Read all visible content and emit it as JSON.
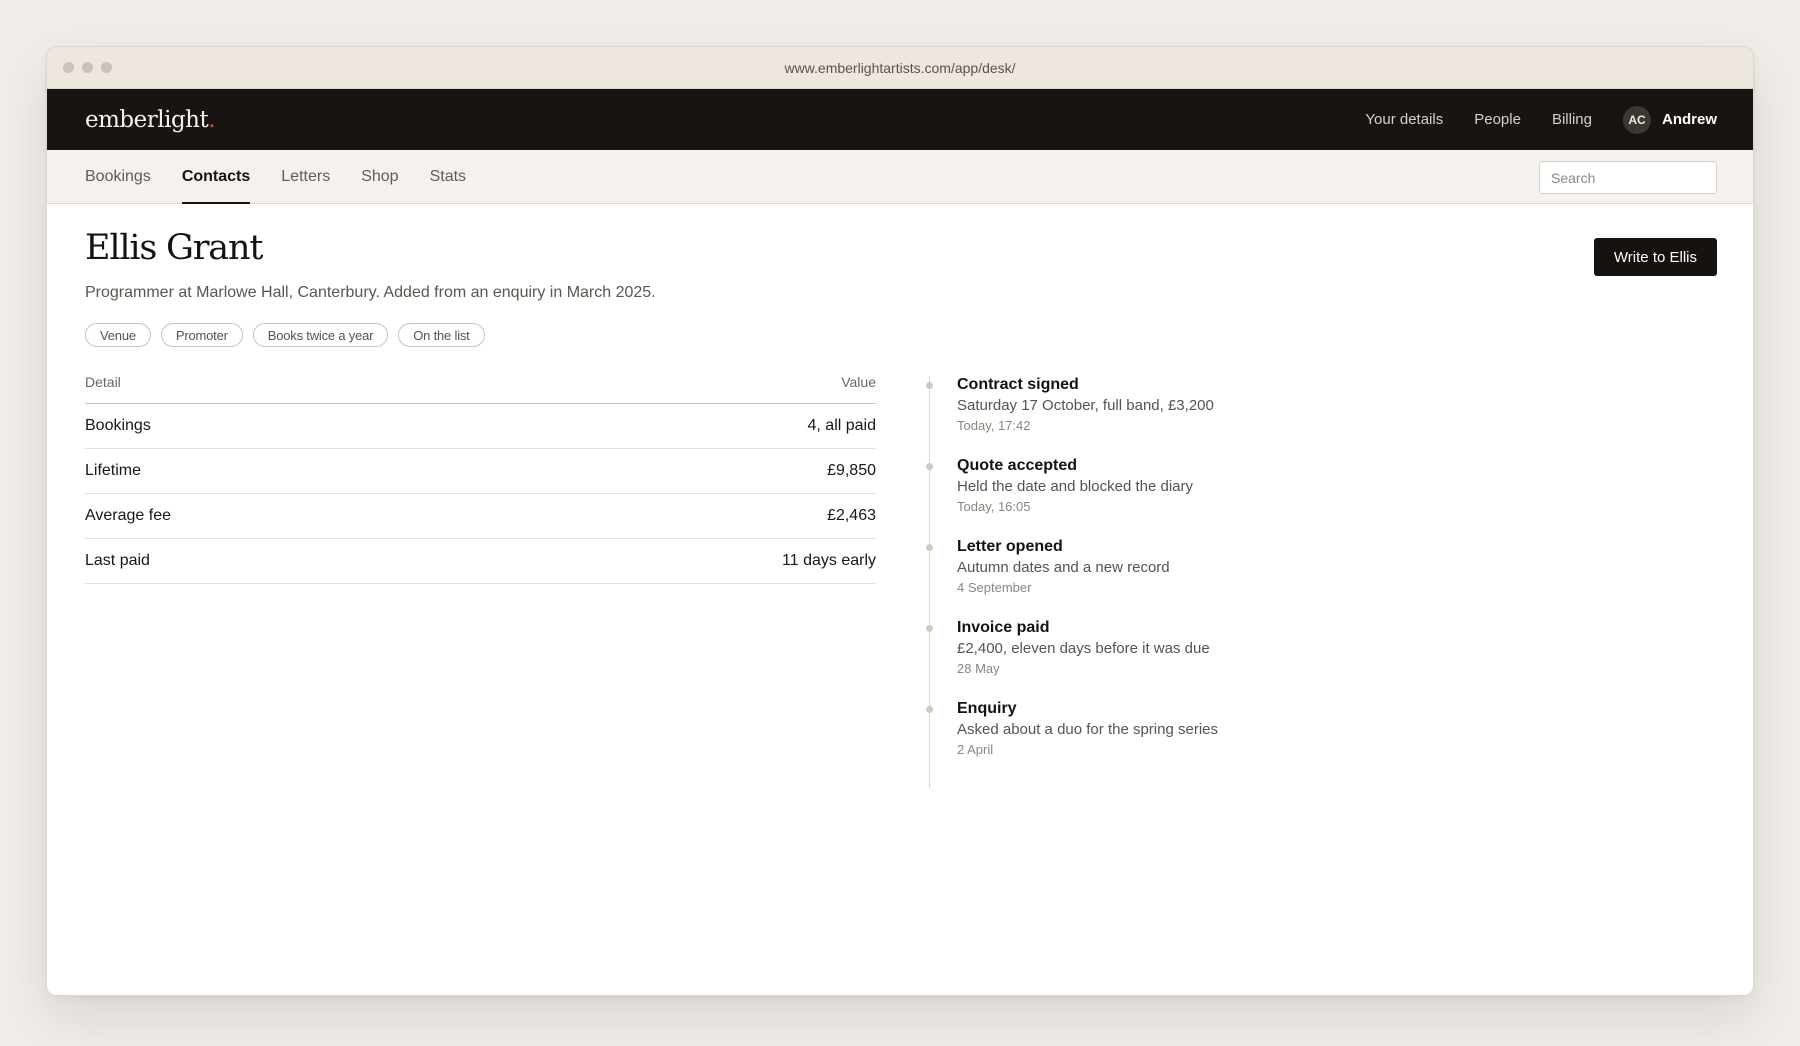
{
  "browser": {
    "url": "www.emberlightartists.com/app/desk/"
  },
  "topbar": {
    "logo": "emberlight",
    "logo_dot": ".",
    "links": [
      "Your details",
      "People",
      "Billing"
    ],
    "user": {
      "initials": "AC",
      "name": "Andrew"
    }
  },
  "subnav": {
    "tabs": [
      "Bookings",
      "Contacts",
      "Letters",
      "Shop",
      "Stats"
    ],
    "active_tab": "Contacts",
    "search_placeholder": "Search"
  },
  "contact": {
    "name": "Ellis Grant",
    "subtitle": "Programmer at Marlowe Hall, Canterbury. Added from an enquiry in March 2025.",
    "write_button": "Write to Ellis",
    "tags": [
      "Venue",
      "Promoter",
      "Books twice a year",
      "On the list"
    ]
  },
  "details": {
    "headers": {
      "detail": "Detail",
      "value": "Value"
    },
    "rows": [
      {
        "label": "Bookings",
        "value": "4, all paid"
      },
      {
        "label": "Lifetime",
        "value": "£9,850"
      },
      {
        "label": "Average fee",
        "value": "£2,463"
      },
      {
        "label": "Last paid",
        "value": "11 days early"
      }
    ]
  },
  "timeline": [
    {
      "title": "Contract signed",
      "desc": "Saturday 17 October, full band, £3,200",
      "time": "Today, 17:42"
    },
    {
      "title": "Quote accepted",
      "desc": "Held the date and blocked the diary",
      "time": "Today, 16:05"
    },
    {
      "title": "Letter opened",
      "desc": "Autumn dates and a new record",
      "time": "4 September"
    },
    {
      "title": "Invoice paid",
      "desc": "£2,400, eleven days before it was due",
      "time": "28 May"
    },
    {
      "title": "Enquiry",
      "desc": "Asked about a duo for the spring series",
      "time": "2 April"
    }
  ]
}
